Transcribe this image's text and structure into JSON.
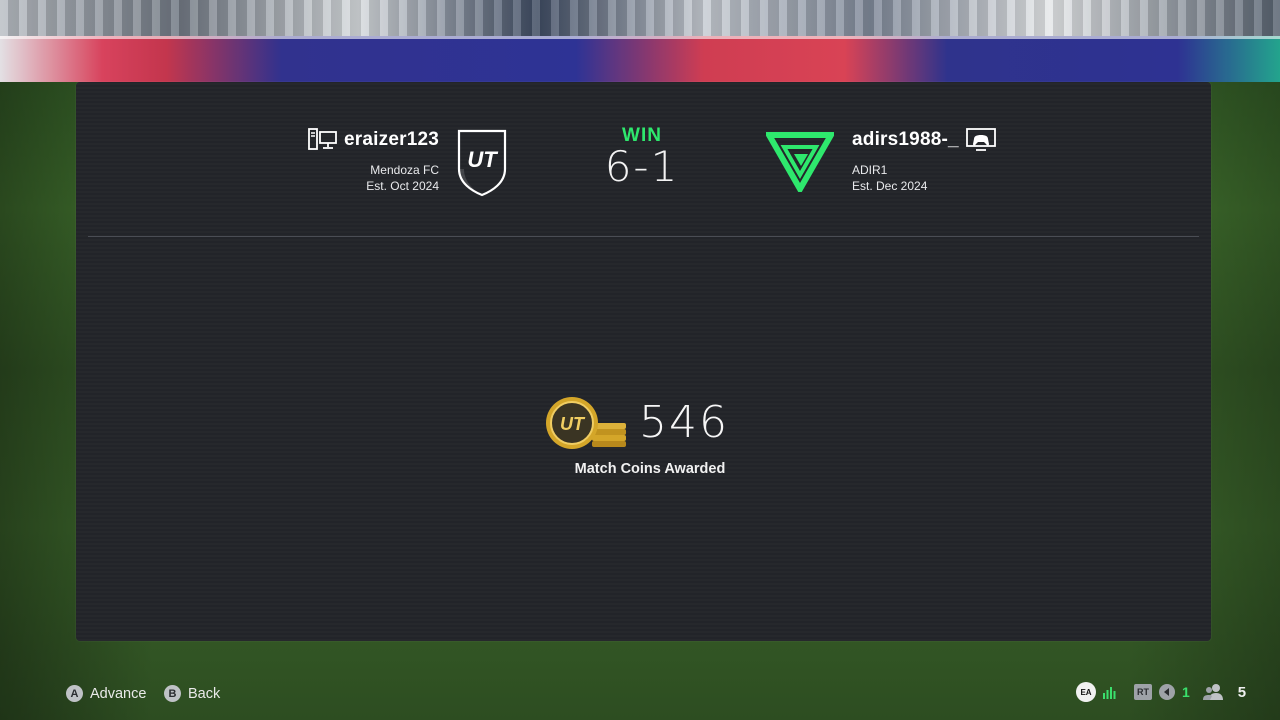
{
  "home": {
    "player_name": "eraizer123",
    "club_name": "Mendoza FC",
    "established": "Est. Oct 2024",
    "platform_icon": "pc-icon",
    "crest_icon": "ut-shield-crest-icon",
    "crest_text": "UT"
  },
  "result": {
    "label": "WIN",
    "score": "6-1",
    "color": "#2ee86d"
  },
  "away": {
    "player_name": "adirs1988-_",
    "club_name": "ADIR1",
    "established": "Est. Dec 2024",
    "platform_icon": "console-icon",
    "crest_icon": "green-triangle-crest-icon",
    "crest_color": "#2ee86d"
  },
  "reward": {
    "amount": "546",
    "caption": "Match Coins Awarded",
    "icon": "ut-coins-icon",
    "coin_text": "UT"
  },
  "controls": {
    "advance": {
      "glyph": "A",
      "label": "Advance"
    },
    "back": {
      "glyph": "B",
      "label": "Back"
    }
  },
  "status": {
    "ea_label": "EA",
    "rt_label": "RT",
    "notification_count": "1",
    "friends_count": "5"
  },
  "colors": {
    "panel": "#23252a",
    "accent_green": "#2ee86d",
    "coin_gold": "#d4a629"
  }
}
